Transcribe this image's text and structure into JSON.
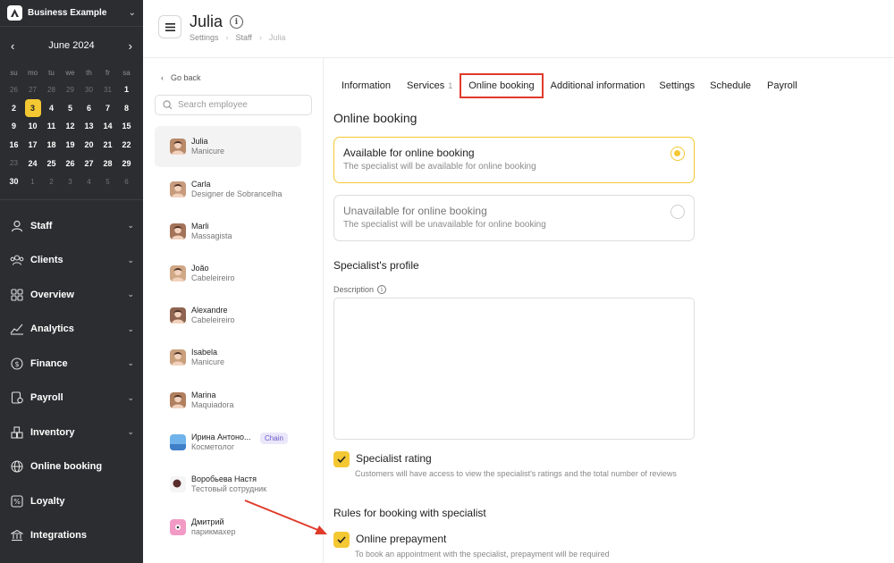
{
  "workspace": {
    "name": "Business Example"
  },
  "calendar": {
    "month_label": "June 2024",
    "weekdays": [
      "su",
      "mo",
      "tu",
      "we",
      "th",
      "fr",
      "sa"
    ],
    "weeks": [
      [
        "26",
        "27",
        "28",
        "29",
        "30",
        "31",
        "1"
      ],
      [
        "2",
        "3",
        "4",
        "5",
        "6",
        "7",
        "8"
      ],
      [
        "9",
        "10",
        "11",
        "12",
        "13",
        "14",
        "15"
      ],
      [
        "16",
        "17",
        "18",
        "19",
        "20",
        "21",
        "22"
      ],
      [
        "23",
        "24",
        "25",
        "26",
        "27",
        "28",
        "29"
      ],
      [
        "30",
        "1",
        "2",
        "3",
        "4",
        "5",
        "6"
      ]
    ],
    "today": "3"
  },
  "sidebar": {
    "items": [
      {
        "label": "Staff",
        "icon": "person-icon",
        "has_chevron": true
      },
      {
        "label": "Clients",
        "icon": "group-icon",
        "has_chevron": true
      },
      {
        "label": "Overview",
        "icon": "grid-icon",
        "has_chevron": true
      },
      {
        "label": "Analytics",
        "icon": "analytics-icon",
        "has_chevron": true
      },
      {
        "label": "Finance",
        "icon": "dollar-icon",
        "has_chevron": true
      },
      {
        "label": "Payroll",
        "icon": "payroll-icon",
        "has_chevron": true
      },
      {
        "label": "Inventory",
        "icon": "boxes-icon",
        "has_chevron": true
      },
      {
        "label": "Online booking",
        "icon": "globe-icon",
        "has_chevron": false
      },
      {
        "label": "Loyalty",
        "icon": "loyalty-icon",
        "has_chevron": false
      },
      {
        "label": "Integrations",
        "icon": "bank-icon",
        "has_chevron": false
      }
    ]
  },
  "header": {
    "title": "Julia",
    "breadcrumb": [
      "Settings",
      "Staff",
      "Julia"
    ]
  },
  "employees": {
    "go_back": "Go back",
    "search_placeholder": "Search employee",
    "list": [
      {
        "name": "Julia",
        "role": "Manicure",
        "active": true,
        "badge": ""
      },
      {
        "name": "Carla",
        "role": "Designer de Sobrancelha",
        "active": false,
        "badge": ""
      },
      {
        "name": "Marli",
        "role": "Massagista",
        "active": false,
        "badge": ""
      },
      {
        "name": "João",
        "role": "Cabeleireiro",
        "active": false,
        "badge": ""
      },
      {
        "name": "Alexandre",
        "role": "Cabeleireiro",
        "active": false,
        "badge": ""
      },
      {
        "name": "Isabela",
        "role": "Manicure",
        "active": false,
        "badge": ""
      },
      {
        "name": "Marina",
        "role": "Maquiadora",
        "active": false,
        "badge": ""
      },
      {
        "name": "Ирина Антоно...",
        "role": "Косметолог",
        "active": false,
        "badge": "Chain"
      },
      {
        "name": "Воробьева Настя",
        "role": "Тестовый сотрудник",
        "active": false,
        "badge": ""
      },
      {
        "name": "Дмитрий",
        "role": "парикмахер",
        "active": false,
        "badge": ""
      }
    ]
  },
  "tabs": [
    {
      "label": "Information",
      "count": ""
    },
    {
      "label": "Services",
      "count": "1"
    },
    {
      "label": "Online booking",
      "count": "",
      "active": true
    },
    {
      "label": "Additional information",
      "count": ""
    },
    {
      "label": "Settings",
      "count": ""
    },
    {
      "label": "Schedule",
      "count": ""
    },
    {
      "label": "Payroll",
      "count": ""
    }
  ],
  "online_booking": {
    "heading": "Online booking",
    "available": {
      "title": "Available for online booking",
      "desc": "The specialist will be available for online booking",
      "selected": true
    },
    "unavailable": {
      "title": "Unavailable for online booking",
      "desc": "The specialist will be unavailable for online booking",
      "selected": false
    },
    "profile_heading": "Specialist's profile",
    "description_label": "Description",
    "description_value": "",
    "rating": {
      "label": "Specialist rating",
      "desc": "Customers will have access to view the specialist's ratings and the total number of reviews",
      "checked": true
    },
    "rules_heading": "Rules for booking with specialist",
    "prepayment": {
      "label": "Online prepayment",
      "desc": "To book an appointment with the specialist, prepayment will be required",
      "checked": true
    }
  },
  "colors": {
    "sidebar_bg": "#2b2d30",
    "accent_yellow": "#f3c833",
    "highlight_red": "#e03a2b"
  }
}
